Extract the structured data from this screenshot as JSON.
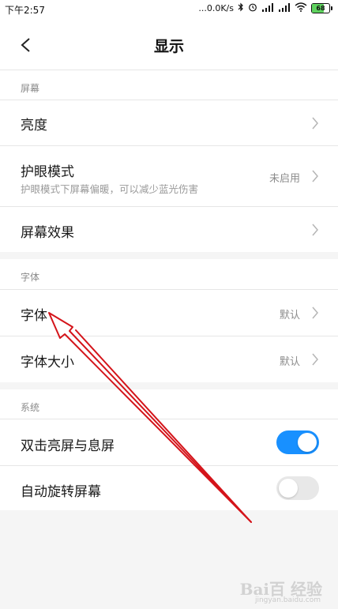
{
  "status_bar": {
    "time": "下午2:57",
    "network_speed": "...0.0K/s",
    "battery": "68",
    "battery_level_percent": 68
  },
  "header": {
    "title": "显示"
  },
  "sections": {
    "screen": {
      "title": "屏幕",
      "brightness_label": "亮度",
      "eye_mode_label": "护眼模式",
      "eye_mode_subtitle": "护眼模式下屏幕偏暖，可以减少蓝光伤害",
      "eye_mode_value": "未启用",
      "screen_effect_label": "屏幕效果"
    },
    "font": {
      "title": "字体",
      "font_label": "字体",
      "font_value": "默认",
      "font_size_label": "字体大小",
      "font_size_value": "默认"
    },
    "system": {
      "title": "系统",
      "double_tap_label": "双击亮屏与息屏",
      "double_tap_enabled": true,
      "auto_rotate_label": "自动旋转屏幕",
      "auto_rotate_enabled": false
    }
  },
  "watermark": {
    "text": "Bai百 经验",
    "subtext": "jingyan.baidu.com"
  },
  "colors": {
    "accent": "#1890ff",
    "annotation_arrow": "#d4141a"
  }
}
